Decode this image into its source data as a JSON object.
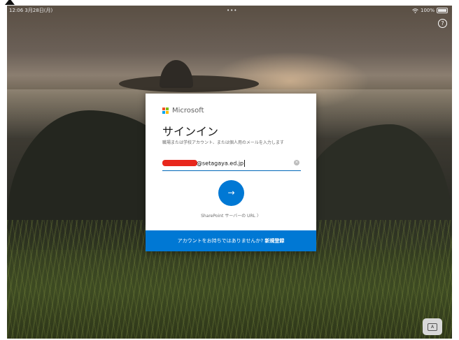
{
  "statusbar": {
    "time": "12:06",
    "date": "3月28日(月)",
    "dots": "•••",
    "battery_text": "100%"
  },
  "icons": {
    "help": "?",
    "next_arrow": "→",
    "clear": "×",
    "chevron": "〉",
    "keyboard": "A"
  },
  "dialog": {
    "brand": "Microsoft",
    "title": "サインイン",
    "subtitle": "職場または学校アカウント、または個人用のメールを入力します",
    "email_value": "@setagaya.ed.jp",
    "sharepoint_link": "SharePoint サーバーの URL",
    "footer_question": "アカウントをお持ちではありませんか?",
    "footer_link": "新規登録"
  },
  "colors": {
    "accent": "#0078d4",
    "ms_red": "#f25022",
    "ms_green": "#7fba00",
    "ms_blue": "#00a4ef",
    "ms_yellow": "#ffb900"
  }
}
